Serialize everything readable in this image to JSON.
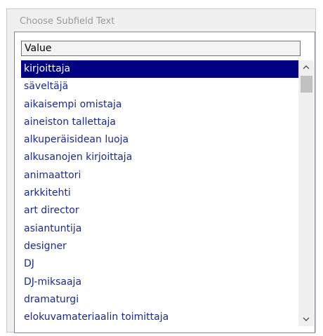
{
  "window": {
    "title": "Choose Subfield Text"
  },
  "list": {
    "column_header": "Value",
    "selected_index": 0,
    "items": [
      "kirjoittaja",
      "säveltäjä",
      "aikaisempi omistaja",
      "aineiston tallettaja",
      "alkuperäisidean luoja",
      "alkusanojen kirjoittaja",
      "animaattori",
      "arkkitehti",
      "art director",
      "asiantuntija",
      "designer",
      "DJ",
      "DJ-miksaaja",
      "dramaturgi",
      "elokuvamateriaalin toimittaja"
    ]
  },
  "icons": {
    "scroll_up": "chevron-up-icon",
    "scroll_down": "chevron-down-icon"
  },
  "colors": {
    "selection_background": "#000080",
    "selection_text": "#ffffff",
    "item_text": "#1c2a8c",
    "title_text": "#9a9a9a"
  }
}
